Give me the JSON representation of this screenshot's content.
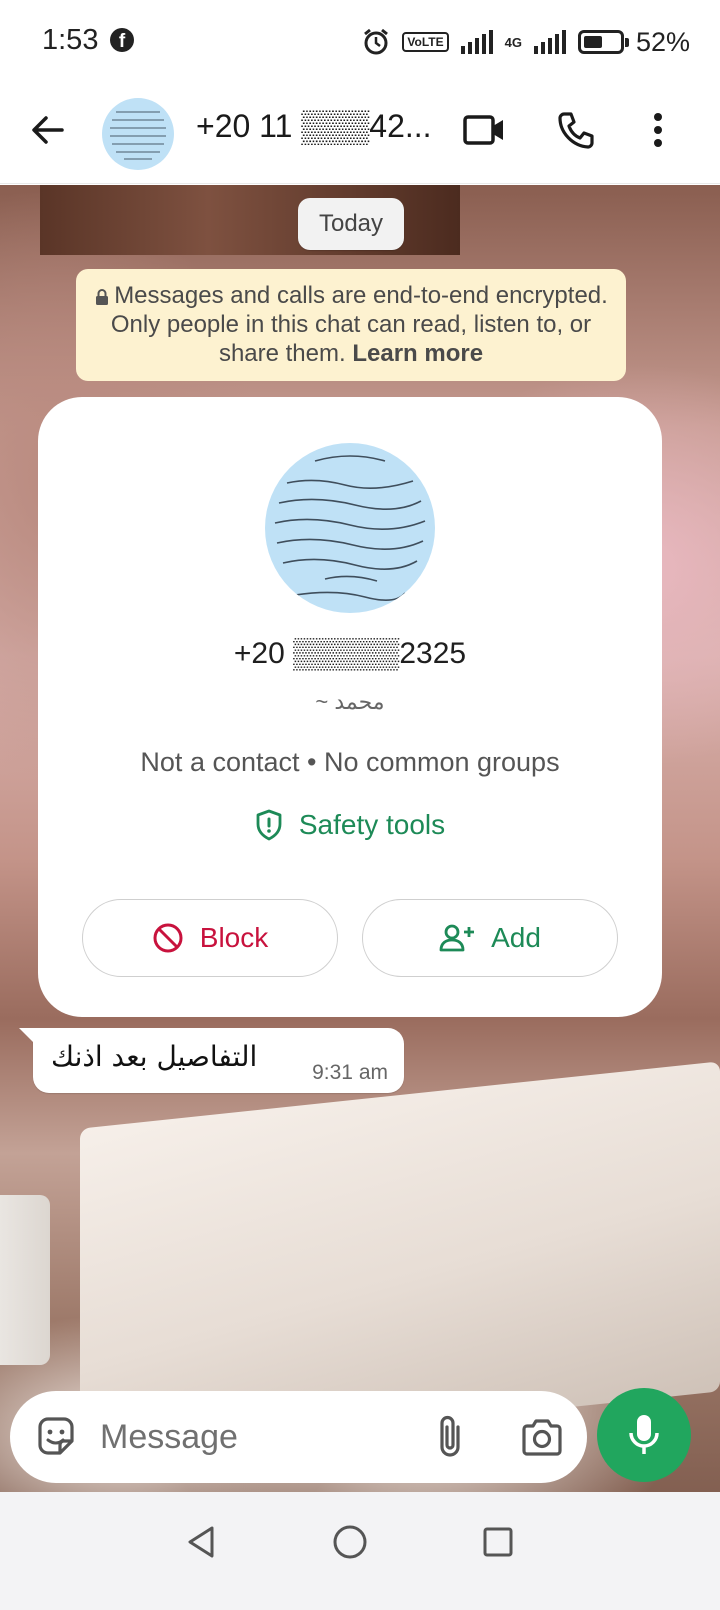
{
  "status_bar": {
    "time": "1:53",
    "battery": "52%",
    "network": "4G",
    "volte": "VoLTE"
  },
  "header": {
    "title": "+20 11 ▒▒▒42...",
    "avatar_icon": "profile-photo-arabic-calligraphy"
  },
  "chat": {
    "date_chip": "Today",
    "encryption_notice": {
      "text": "Messages and calls are end-to-end encrypted. Only people in this chat can read, listen to, or share them.",
      "link": "Learn more"
    },
    "contact_card": {
      "phone": "+20 ▒▒▒▒▒2325",
      "name": "~ محمد",
      "meta": "Not a contact • No common groups",
      "safety_tools_label": "Safety tools",
      "block_label": "Block",
      "add_label": "Add"
    },
    "messages": [
      {
        "text": "التفاصيل بعد اذنك",
        "time": "9:31 am",
        "direction": "incoming"
      }
    ]
  },
  "input": {
    "placeholder": "Message"
  },
  "colors": {
    "accent_green": "#21a65e",
    "block_red": "#c8123d",
    "notice_bg": "#fdf2d0"
  }
}
